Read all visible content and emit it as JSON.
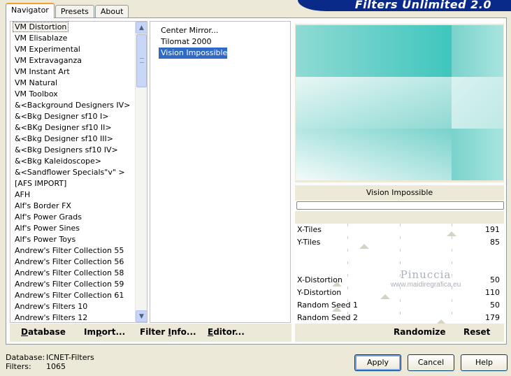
{
  "tabs": [
    {
      "label": "Navigator",
      "active": true
    },
    {
      "label": "Presets",
      "active": false
    },
    {
      "label": "About",
      "active": false
    }
  ],
  "brand": {
    "title": "Filters Unlimited 2.0",
    "color": "#0a2a8a"
  },
  "categories": {
    "items": [
      "VM Distortion",
      "VM Elisablaze",
      "VM Experimental",
      "VM Extravaganza",
      "VM Instant Art",
      "VM Natural",
      "VM Toolbox",
      "&<Background Designers IV>",
      "&<Bkg Designer sf10 I>",
      "&<BKg Designer sf10 II>",
      "&<Bkg Designer sf10 III>",
      "&<Bkg Designers sf10 IV>",
      "&<Bkg Kaleidoscope>",
      "&<Sandflower Specials\"v\" >",
      "[AFS IMPORT]",
      "AFH",
      "Alf's Border FX",
      "Alf's Power Grads",
      "Alf's Power Sines",
      "Alf's Power Toys",
      "Andrew's Filter Collection 55",
      "Andrew's Filter Collection 56",
      "Andrew's Filter Collection 58",
      "Andrew's Filter Collection 59",
      "Andrew's Filter Collection 61",
      "Andrew's Filters 10",
      "Andrew's Filters 12"
    ],
    "focused_index": 0
  },
  "filters": {
    "items": [
      "Center Mirror...",
      "Tilomat 2000",
      "Vision Impossible"
    ],
    "selected_index": 2
  },
  "preview": {
    "base_color": "#3fc6bd"
  },
  "filter_name": "Vision Impossible",
  "params": [
    {
      "label": "X-Tiles",
      "value": "191",
      "level": 0.75
    },
    {
      "label": "Y-Tiles",
      "value": "85",
      "level": 0.33
    },
    {
      "label": "",
      "value": "",
      "level": null
    },
    {
      "label": "",
      "value": "",
      "level": null
    },
    {
      "label": "X-Distortion",
      "value": "50",
      "level": 0.2
    },
    {
      "label": "Y-Distortion",
      "value": "110",
      "level": 0.43
    },
    {
      "label": "Random Seed 1",
      "value": "50",
      "level": 0.2
    },
    {
      "label": "Random Seed 2",
      "value": "179",
      "level": 0.7
    }
  ],
  "watermark": {
    "line1": "Pinuccia",
    "line2": "www.maidiregrafica.eu"
  },
  "left_buttons": {
    "database": {
      "pre": "",
      "u": "D",
      "post": "atabase"
    },
    "import": {
      "pre": "Im",
      "u": "p",
      "post": "ort..."
    },
    "filter_info": {
      "pre": "Filter ",
      "u": "I",
      "post": "nfo..."
    },
    "editor": {
      "pre": "",
      "u": "E",
      "post": "ditor..."
    }
  },
  "right_buttons": {
    "randomize": "Randomize",
    "reset": "Reset"
  },
  "info": {
    "database_label": "Database:",
    "database_value": "ICNET-Filters",
    "filters_label": "Filters:",
    "filters_value": "1065"
  },
  "dialog_buttons": {
    "apply": "Apply",
    "cancel": "Cancel",
    "help": "Help"
  }
}
